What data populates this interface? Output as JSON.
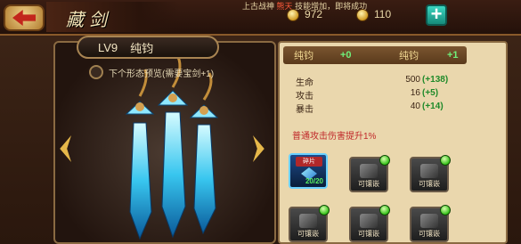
{
  "header": {
    "title": "藏剑",
    "stats_text_1": "上古战神",
    "stats_text_red": "熊天",
    "stats_text_2": "技能增加，即将成功",
    "currency_1": "972",
    "currency_2": "110"
  },
  "weapon": {
    "level": "LV9",
    "name": "纯钧",
    "preview_label": "下个形态预览(需要宝剑+1)"
  },
  "detail": {
    "name_left_label": "纯钧",
    "name_left_value": "+0",
    "name_right_label": "纯钧",
    "name_right_value": "+1",
    "stats": [
      {
        "label": "生命",
        "value": "500",
        "bonus": "+138"
      },
      {
        "label": "攻击",
        "value": "16",
        "bonus": "+5"
      },
      {
        "label": "暴击",
        "value": "40",
        "bonus": "+14"
      }
    ],
    "effect_text": "普通攻击伤害提升1%"
  },
  "slots": [
    {
      "tag": "碎片",
      "count": "20/20",
      "active": true
    },
    {
      "label": "可镶嵌"
    },
    {
      "label": "可镶嵌"
    },
    {
      "label": "可镶嵌"
    },
    {
      "label": "可镶嵌"
    },
    {
      "label": "可镶嵌"
    }
  ],
  "colors": {
    "accent_gold": "#d8b060",
    "bonus_green": "#1f8a2a",
    "effect_red": "#c0282a",
    "plus_teal": "#2ab4a2"
  }
}
